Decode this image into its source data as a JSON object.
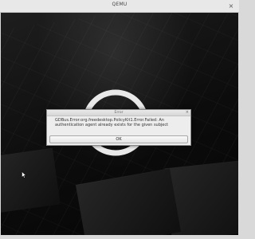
{
  "window": {
    "title": "QEMU",
    "close_glyph": "×"
  },
  "dialog": {
    "title": "Error",
    "close_glyph": "×",
    "message": "GDBus.Error:org.freedesktop.PolicyKit1.Error.Failed: An authentication agent already exists for the given subject",
    "ok_label": "OK"
  },
  "icons": {
    "logo": "linux-mint-logo-icon",
    "cursor": "mouse-pointer-icon",
    "close": "close-icon"
  },
  "colors": {
    "desktop": "#0c0c0c",
    "dialog": "#ededed",
    "titlebar": "#e8e8e8"
  }
}
